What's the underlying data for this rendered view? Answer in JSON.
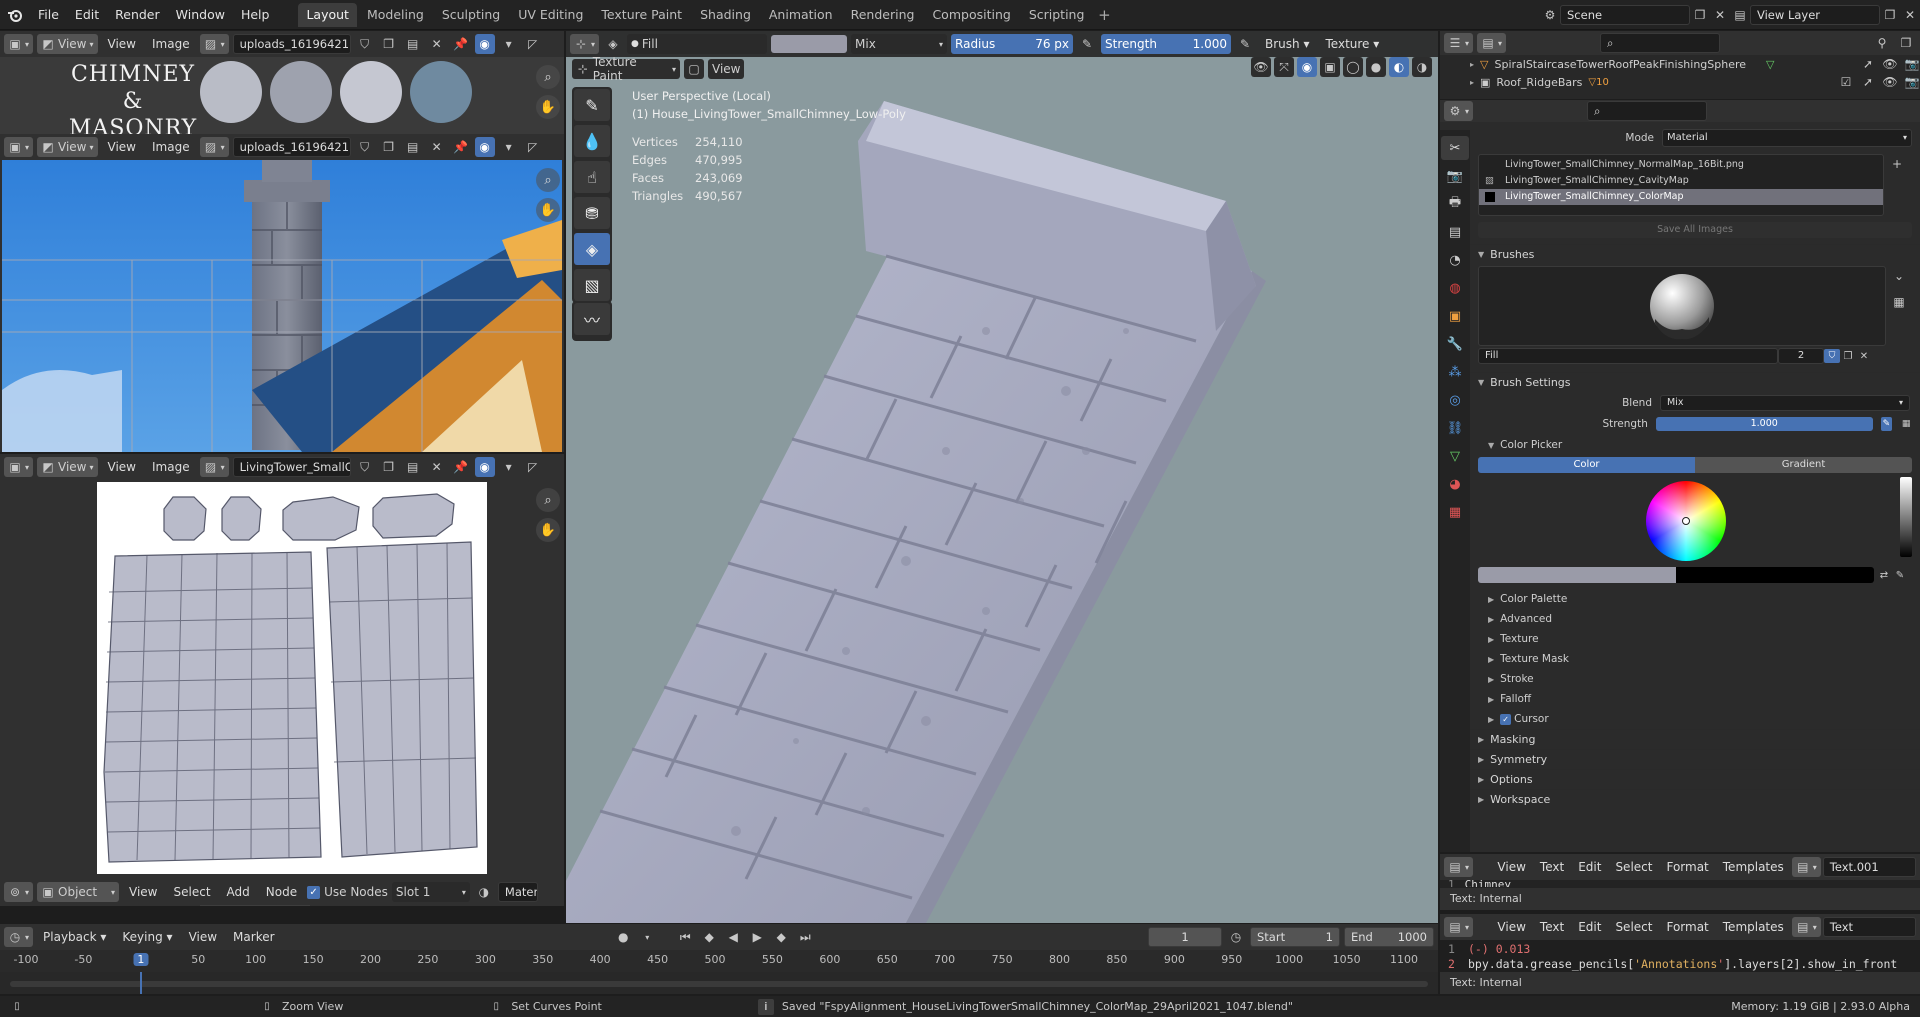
{
  "topbar": {
    "menus": [
      "File",
      "Edit",
      "Render",
      "Window",
      "Help"
    ],
    "workspaces": [
      "Layout",
      "Modeling",
      "Sculpting",
      "UV Editing",
      "Texture Paint",
      "Shading",
      "Animation",
      "Rendering",
      "Compositing",
      "Scripting"
    ],
    "active_workspace": "Layout",
    "add_icon": "plus-icon",
    "scene_label": "Scene",
    "view_layer_label": "View Layer"
  },
  "image_editor_1": {
    "view": "View",
    "view2": "View",
    "image": "Image",
    "image_name": "uploads_16196421...",
    "title_line1": "CHIMNEY",
    "title_line2": "& MASONRY",
    "swatches": [
      "#b9bcc6",
      "#9ea2ae",
      "#c5c7d1",
      "#6f8aa0"
    ]
  },
  "image_editor_2": {
    "view": "View",
    "view2": "View",
    "image": "Image",
    "image_name": "uploads_16196421..."
  },
  "image_editor_3": {
    "view": "View",
    "view2": "View",
    "image": "Image",
    "image_name": "LivingTower_SmallC..."
  },
  "node_header": {
    "mode": "Object",
    "view": "View",
    "select": "Select",
    "add": "Add",
    "node": "Node",
    "use_nodes": "Use Nodes",
    "slot": "Slot 1",
    "material": "Materi"
  },
  "tool_header": {
    "brush_name": "Fill",
    "blend": "Mix",
    "radius_label": "Radius",
    "radius_value": "76 px",
    "strength_label": "Strength",
    "strength_value": "1.000",
    "brush_menu": "Brush",
    "texture_menu": "Texture",
    "mode_select": "Texture Paint",
    "view": "View"
  },
  "viewport": {
    "perspective": "User Perspective (Local)",
    "object": "(1) House_LivingTower_SmallChimney_Low-Poly",
    "stats": [
      {
        "label": "Vertices",
        "value": "254,110"
      },
      {
        "label": "Edges",
        "value": "470,995"
      },
      {
        "label": "Faces",
        "value": "243,069"
      },
      {
        "label": "Triangles",
        "value": "490,567"
      }
    ]
  },
  "outliner": {
    "items": [
      {
        "name": "SpiralStaircaseTowerRoofPeakFinishingSphere",
        "badge": ""
      },
      {
        "name": "Roof_RidgeBars",
        "badge": "10"
      }
    ]
  },
  "properties": {
    "mode_label": "Mode",
    "mode_value": "Material",
    "images": [
      "LivingTower_SmallChimney_NormalMap_16Bit.png",
      "LivingTower_SmallChimney_CavityMap",
      "LivingTower_SmallChimney_ColorMap"
    ],
    "save_all": "Save All Images",
    "brushes_label": "Brushes",
    "brush_name": "Fill",
    "brush_users": "2",
    "brush_settings": "Brush Settings",
    "blend_label": "Blend",
    "blend_value": "Mix",
    "strength_label": "Strength",
    "strength_value": "1.000",
    "strength_fraction": 1.0,
    "color_picker": "Color Picker",
    "color_tab": "Color",
    "gradient_tab": "Gradient",
    "subsections": [
      "Color Palette",
      "Advanced",
      "Texture",
      "Texture Mask",
      "Stroke",
      "Falloff",
      "Cursor"
    ],
    "sections": [
      "Masking",
      "Symmetry",
      "Options",
      "Workspace"
    ]
  },
  "text_editor_1": {
    "view": "View",
    "text": "Text",
    "edit": "Edit",
    "select": "Select",
    "format": "Format",
    "templates": "Templates",
    "name": "Text.001",
    "line": "Chimney",
    "footer": "Text: Internal"
  },
  "text_editor_2": {
    "view": "View",
    "text": "Text",
    "edit": "Edit",
    "select": "Select",
    "format": "Format",
    "templates": "Templates",
    "name": "Text",
    "line_numbers": [
      "1",
      "2"
    ],
    "line1": "(-) 0.013",
    "line2_a": "bpy.data.grease_pencils[",
    "line2_b": "'Annotations",
    "line2_c": "'",
    "line2_d": "].layers[2].show_in_front",
    "footer": "Text: Internal"
  },
  "timeline": {
    "playback": "Playback",
    "keying": "Keying",
    "view": "View",
    "marker": "Marker",
    "current_frame": "1",
    "start_label": "Start",
    "start": "1",
    "end_label": "End",
    "end": "1000",
    "ticks": [
      "-100",
      "-50",
      "1",
      "50",
      "100",
      "150",
      "200",
      "250",
      "300",
      "350",
      "400",
      "450",
      "500",
      "550",
      "600",
      "650",
      "700",
      "750",
      "800",
      "850",
      "900",
      "950",
      "1000",
      "1050",
      "1100"
    ]
  },
  "statusbar": {
    "zoom": "Zoom View",
    "curves": "Set Curves Point",
    "saved": "Saved \"FspyAlignment_HouseLivingTowerSmallChimney_ColorMap_29April2021_1047.blend\"",
    "memory": "Memory: 1.19 GiB | 2.93.0 Alpha"
  },
  "colors": {
    "accent": "#4772b3",
    "viewport_bg": "#8a9a9e",
    "mesh": "#a7abc2"
  }
}
